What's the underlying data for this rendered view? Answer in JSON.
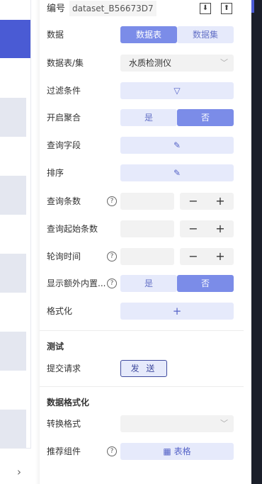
{
  "header": {
    "id_label": "编号",
    "id_value": "dataset_B56673D7"
  },
  "rows": {
    "data_label": "数据",
    "data_seg": [
      "数据表",
      "数据集"
    ],
    "table_label": "数据表/集",
    "table_value": "水质检测仪",
    "filter_label": "过滤条件",
    "aggregate_label": "开启聚合",
    "aggregate_seg": [
      "是",
      "否"
    ],
    "fields_label": "查询字段",
    "sort_label": "排序",
    "count_label": "查询条数",
    "start_label": "查询起始条数",
    "poll_label": "轮询时间",
    "extra_label": "显示额外内置...",
    "extra_seg": [
      "是",
      "否"
    ],
    "format_label": "格式化"
  },
  "test": {
    "title": "测试",
    "submit_label": "提交请求",
    "send_button": "发 送"
  },
  "dataformat": {
    "title": "数据格式化",
    "convert_label": "转换格式",
    "recommend_label": "推荐组件",
    "recommend_value": "表格"
  },
  "icons": {
    "help": "?",
    "minus": "−",
    "plus": "+",
    "chevron": "›"
  },
  "colors": {
    "accent": "#7b8ce8",
    "lavender": "#e6eafb",
    "sidebar_active": "#4a5bd4"
  }
}
